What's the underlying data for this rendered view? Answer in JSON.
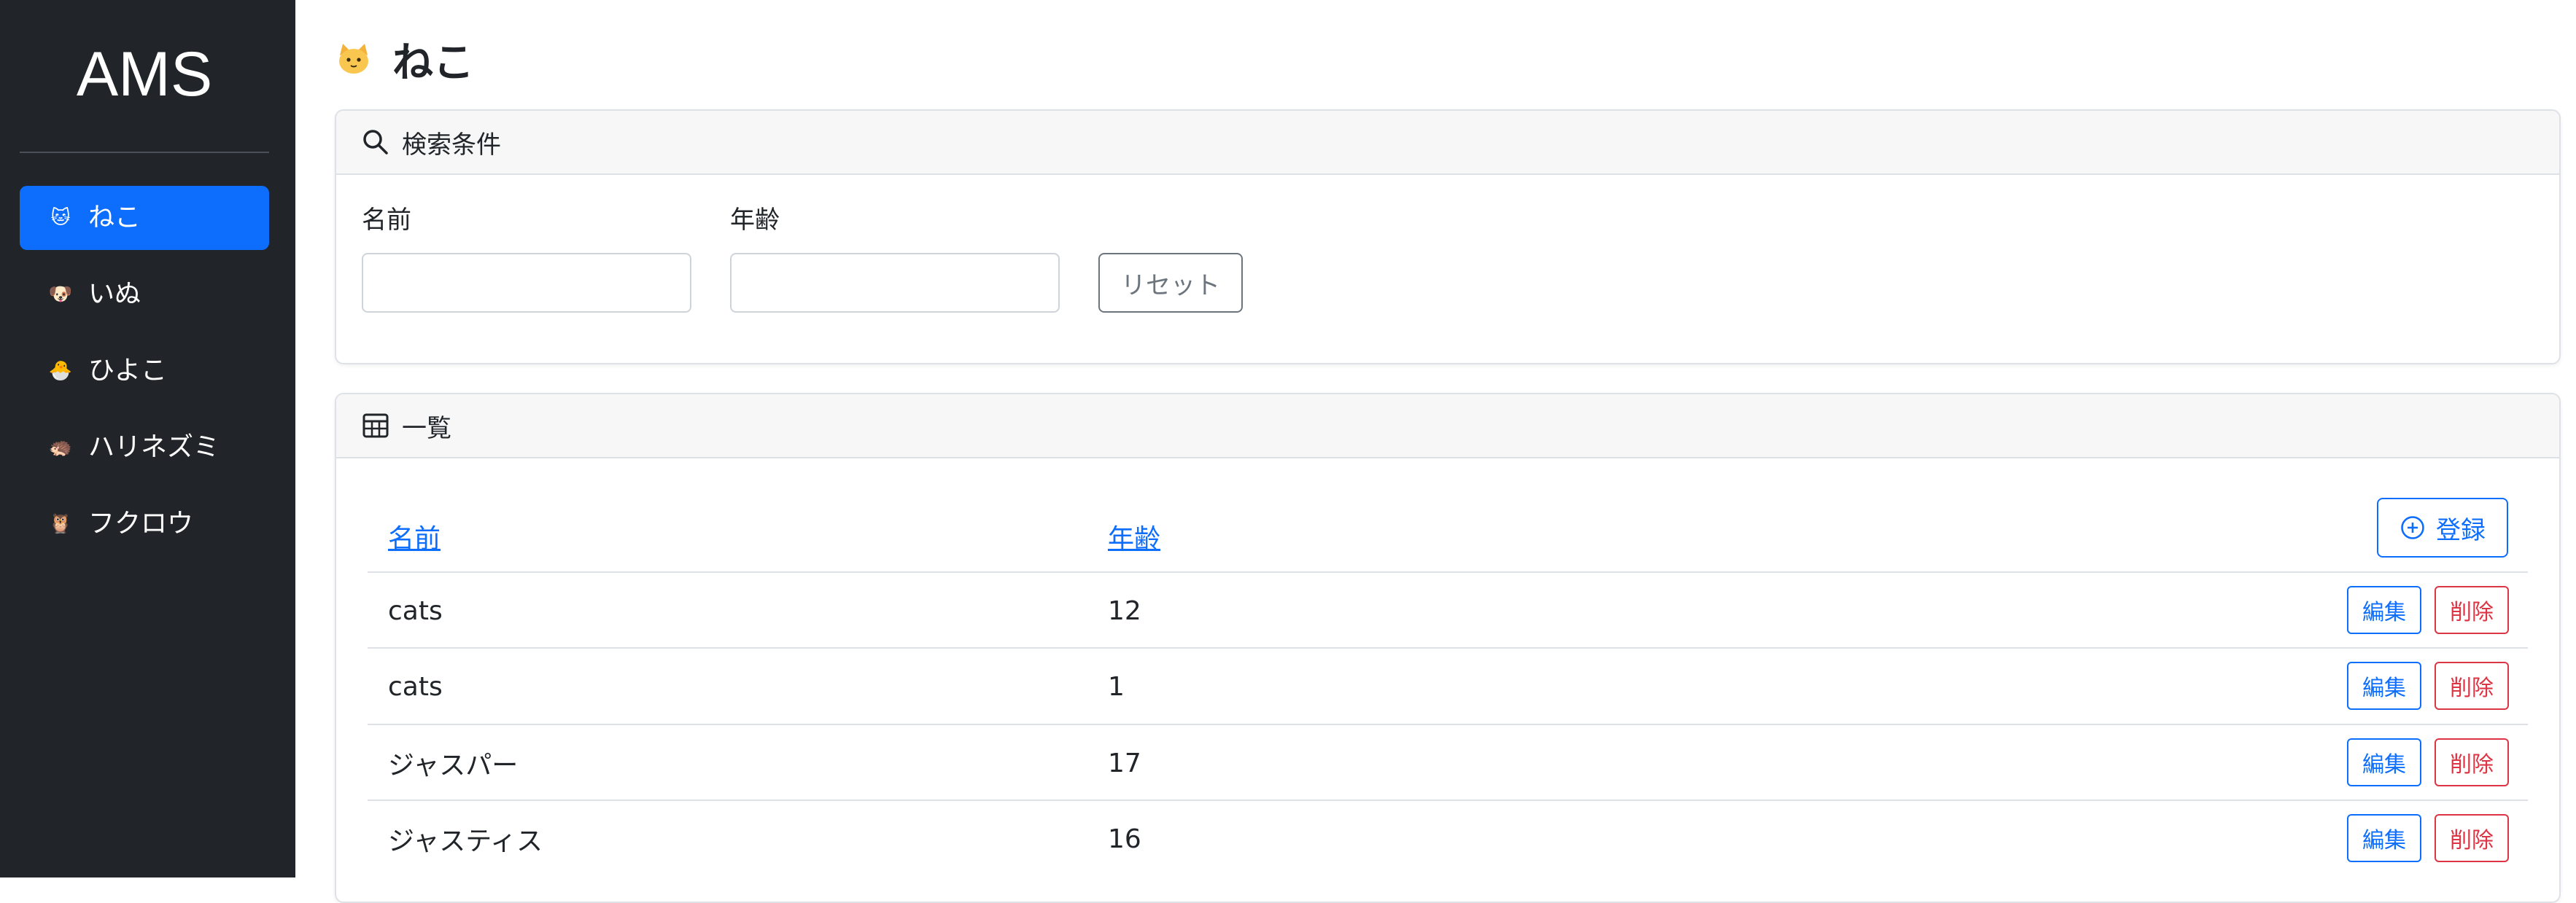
{
  "app": {
    "brand": "AMS"
  },
  "sidebar": {
    "items": [
      {
        "label": "ねこ",
        "emoji": "🐱",
        "icon": "cat-icon",
        "active": true
      },
      {
        "label": "いぬ",
        "emoji": "🐶",
        "icon": "dog-icon",
        "active": false
      },
      {
        "label": "ひよこ",
        "emoji": "🐣",
        "icon": "chick-icon",
        "active": false
      },
      {
        "label": "ハリネズミ",
        "emoji": "🦔",
        "icon": "hedgehog-icon",
        "active": false
      },
      {
        "label": "フクロウ",
        "emoji": "🦉",
        "icon": "owl-icon",
        "active": false
      }
    ]
  },
  "page": {
    "title": "ねこ",
    "title_icon": "cat-icon"
  },
  "search": {
    "header": "検索条件",
    "header_icon": "search-icon",
    "name_label": "名前",
    "name_value": "",
    "age_label": "年齢",
    "age_value": "",
    "reset_label": "リセット"
  },
  "list": {
    "header": "一覧",
    "header_icon": "table-icon",
    "columns": [
      "名前",
      "年齢"
    ],
    "register_label": "登録",
    "register_icon": "plus-circle-icon",
    "edit_label": "編集",
    "delete_label": "削除",
    "rows": [
      {
        "name": "cats",
        "age": "12"
      },
      {
        "name": "cats",
        "age": "1"
      },
      {
        "name": "ジャスパー",
        "age": "17"
      },
      {
        "name": "ジャスティス",
        "age": "16"
      }
    ]
  },
  "colors": {
    "sidebar_bg": "#212529",
    "primary": "#0d6efd",
    "danger": "#dc3545",
    "secondary": "#6c757d"
  }
}
